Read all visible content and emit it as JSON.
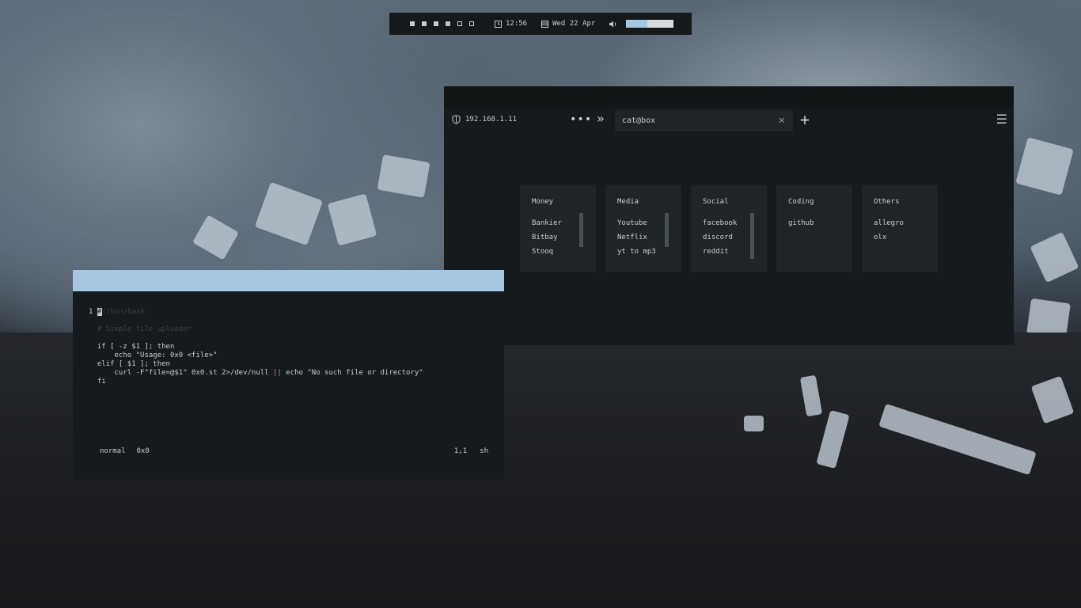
{
  "topbar": {
    "workspaces": [
      {
        "state": "filled"
      },
      {
        "state": "filled"
      },
      {
        "state": "filled"
      },
      {
        "state": "active"
      },
      {
        "state": "empty"
      },
      {
        "state": "empty"
      }
    ],
    "clock_icon": "clock-icon",
    "time": "12:56",
    "calendar_icon": "calendar-icon",
    "date": "Wed 22 Apr",
    "volume_icon": "speaker-icon",
    "volume_level": 0.45,
    "accent": "#a9c6e0"
  },
  "browser": {
    "url": "192.168.1.11",
    "overflow_label": "•••",
    "chevron": "»",
    "tab_title": "cat@box",
    "tab_close": "✕",
    "new_tab": "+",
    "menu": "☰",
    "cards": [
      {
        "title": "Money",
        "links": [
          "Bankier",
          "Bitbay",
          "Stooq"
        ],
        "scroll": true
      },
      {
        "title": "Media",
        "links": [
          "Youtube",
          "Netflix",
          "yt to mp3"
        ],
        "scroll": true
      },
      {
        "title": "Social",
        "links": [
          "facebook",
          "discord",
          "reddit"
        ],
        "scroll": true
      },
      {
        "title": "Coding",
        "links": [
          "github"
        ],
        "scroll": false
      },
      {
        "title": "Others",
        "links": [
          "allegro",
          "olx"
        ],
        "scroll": false
      }
    ]
  },
  "terminal": {
    "line_number": "1",
    "cursor_char": "#",
    "lines": {
      "l1": "!/bin/bash",
      "l2": "",
      "l3": "# Simple file uploader",
      "l4": "",
      "l5a": "if [ -z $1 ]; then",
      "l6": "    echo \"Usage: 0x0 <file>\"",
      "l7": "elif [ $1 ]; then",
      "l8a": "    curl -F\"file=@$1\" 0x0.st 2>/dev/null ",
      "l8b": "||",
      "l8c": " echo \"No such file or directory\"",
      "l9": "fi"
    },
    "status_mode": "normal",
    "status_file": "0x0",
    "status_pos": "1,1",
    "status_ft": "sh"
  }
}
